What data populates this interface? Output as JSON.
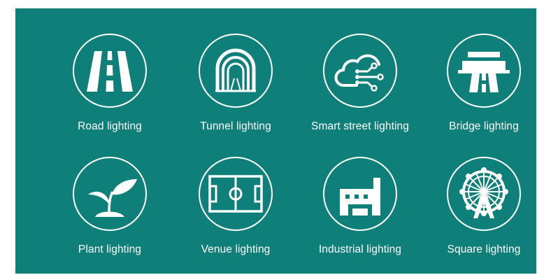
{
  "colors": {
    "panel": "#0f7f79",
    "foreground": "#ffffff"
  },
  "items": [
    {
      "label": "Road lighting",
      "icon": "road-icon"
    },
    {
      "label": "Tunnel lighting",
      "icon": "tunnel-icon"
    },
    {
      "label": "Smart street lighting",
      "icon": "cloud-circuit-icon"
    },
    {
      "label": "Bridge lighting",
      "icon": "bridge-icon"
    },
    {
      "label": "Plant lighting",
      "icon": "sprout-icon"
    },
    {
      "label": "Venue lighting",
      "icon": "football-field-icon"
    },
    {
      "label": "Industrial lighting",
      "icon": "factory-icon"
    },
    {
      "label": "Square lighting",
      "icon": "ferris-wheel-icon"
    }
  ]
}
